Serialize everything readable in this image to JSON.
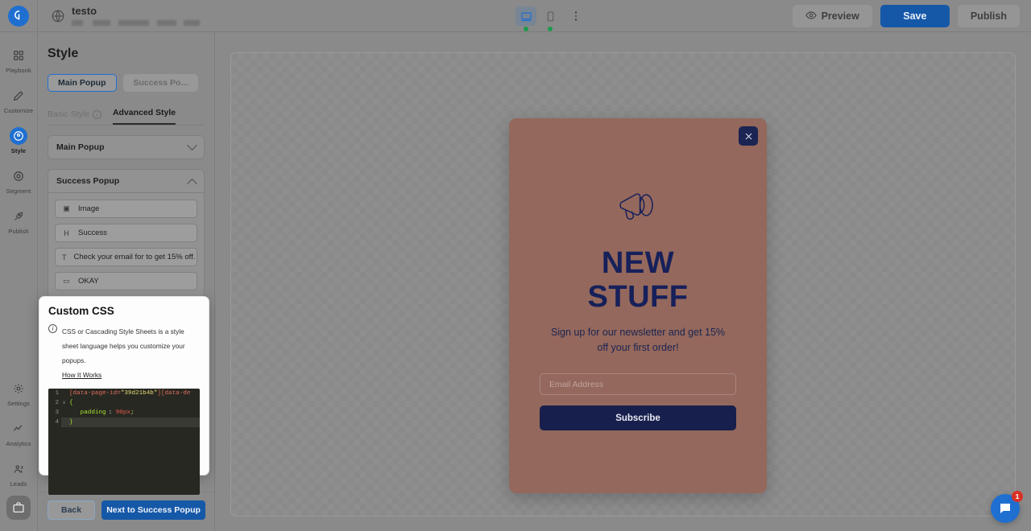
{
  "topbar": {
    "doc_title": "testo",
    "device_desktop": "desktop-view",
    "device_mobile": "mobile-view",
    "more_label": "more-options",
    "preview_label": "Preview",
    "save_label": "Save",
    "publish_label": "Publish"
  },
  "rail": {
    "items": [
      {
        "label": "Playbook",
        "icon": "grid-icon",
        "active": false
      },
      {
        "label": "Customize",
        "icon": "pencil-icon",
        "active": false
      },
      {
        "label": "Style",
        "icon": "palette-icon",
        "active": true
      },
      {
        "label": "Segment",
        "icon": "target-icon",
        "active": false
      },
      {
        "label": "Publish",
        "icon": "rocket-icon",
        "active": false
      },
      {
        "label": "Settings",
        "icon": "gear-icon",
        "active": false
      },
      {
        "label": "Analytics",
        "icon": "line-chart-icon",
        "active": false
      },
      {
        "label": "Leads",
        "icon": "people-icon",
        "active": false
      }
    ],
    "bottom_icon": "briefcase-icon"
  },
  "panel": {
    "title": "Style",
    "segments": [
      {
        "label": "Main Popup",
        "selected": true
      },
      {
        "label": "Success Po...",
        "selected": false
      }
    ],
    "tabs": [
      {
        "label": "Basic Style",
        "active": false,
        "info": "i"
      },
      {
        "label": "Advanced Style",
        "active": true
      }
    ],
    "accordions": [
      {
        "title": "Main Popup",
        "expanded": false
      },
      {
        "title": "Success Popup",
        "expanded": true
      }
    ],
    "success_layers": [
      {
        "icon": "image-icon",
        "glyph": "▣",
        "label": "Image"
      },
      {
        "icon": "heading-icon",
        "glyph": "H",
        "label": "Success"
      },
      {
        "icon": "text-icon",
        "glyph": "T",
        "label": "Check your email for to get 15% off."
      },
      {
        "icon": "button-icon",
        "glyph": "▭",
        "label": "OKAY"
      }
    ],
    "footer": {
      "back_label": "Back",
      "next_label": "Next to Success Popup"
    }
  },
  "custom_css": {
    "title": "Custom CSS",
    "info_glyph": "i",
    "description": "CSS or Cascading Style Sheets is a style sheet language helps you customize your popups.",
    "link_label": "How It Works",
    "code_lines": [
      {
        "n": "1",
        "fold": "",
        "highlight": false,
        "tokens": [
          {
            "t": "[data-page-id=",
            "c": "t-attr"
          },
          {
            "t": "\"39d21b4b\"",
            "c": "t-str"
          },
          {
            "t": "][data-de",
            "c": "t-attr"
          }
        ]
      },
      {
        "n": "2",
        "fold": "∨",
        "highlight": false,
        "tokens": [
          {
            "t": "{",
            "c": "t-brace"
          }
        ]
      },
      {
        "n": "3",
        "fold": "",
        "highlight": false,
        "tokens": [
          {
            "t": "   padding",
            "c": "t-prop"
          },
          {
            "t": ": ",
            "c": "code"
          },
          {
            "t": "90",
            "c": "t-num"
          },
          {
            "t": "px",
            "c": "t-num"
          },
          {
            "t": ";",
            "c": "t-semi"
          }
        ]
      },
      {
        "n": "4",
        "fold": "",
        "highlight": true,
        "tokens": [
          {
            "t": "}",
            "c": "t-brace"
          }
        ]
      }
    ]
  },
  "popup": {
    "close_label": "close-popup",
    "icon": "megaphone-icon",
    "heading_line1": "NEW",
    "heading_line2": "STUFF",
    "subtext": "Sign up for our newsletter and get 15% off your first order!",
    "email_placeholder": "Email Address",
    "subscribe_label": "Subscribe",
    "background_color": "#94685c",
    "accent_color": "#171f4d"
  },
  "chat": {
    "label": "chat-widget",
    "badge": "1"
  }
}
